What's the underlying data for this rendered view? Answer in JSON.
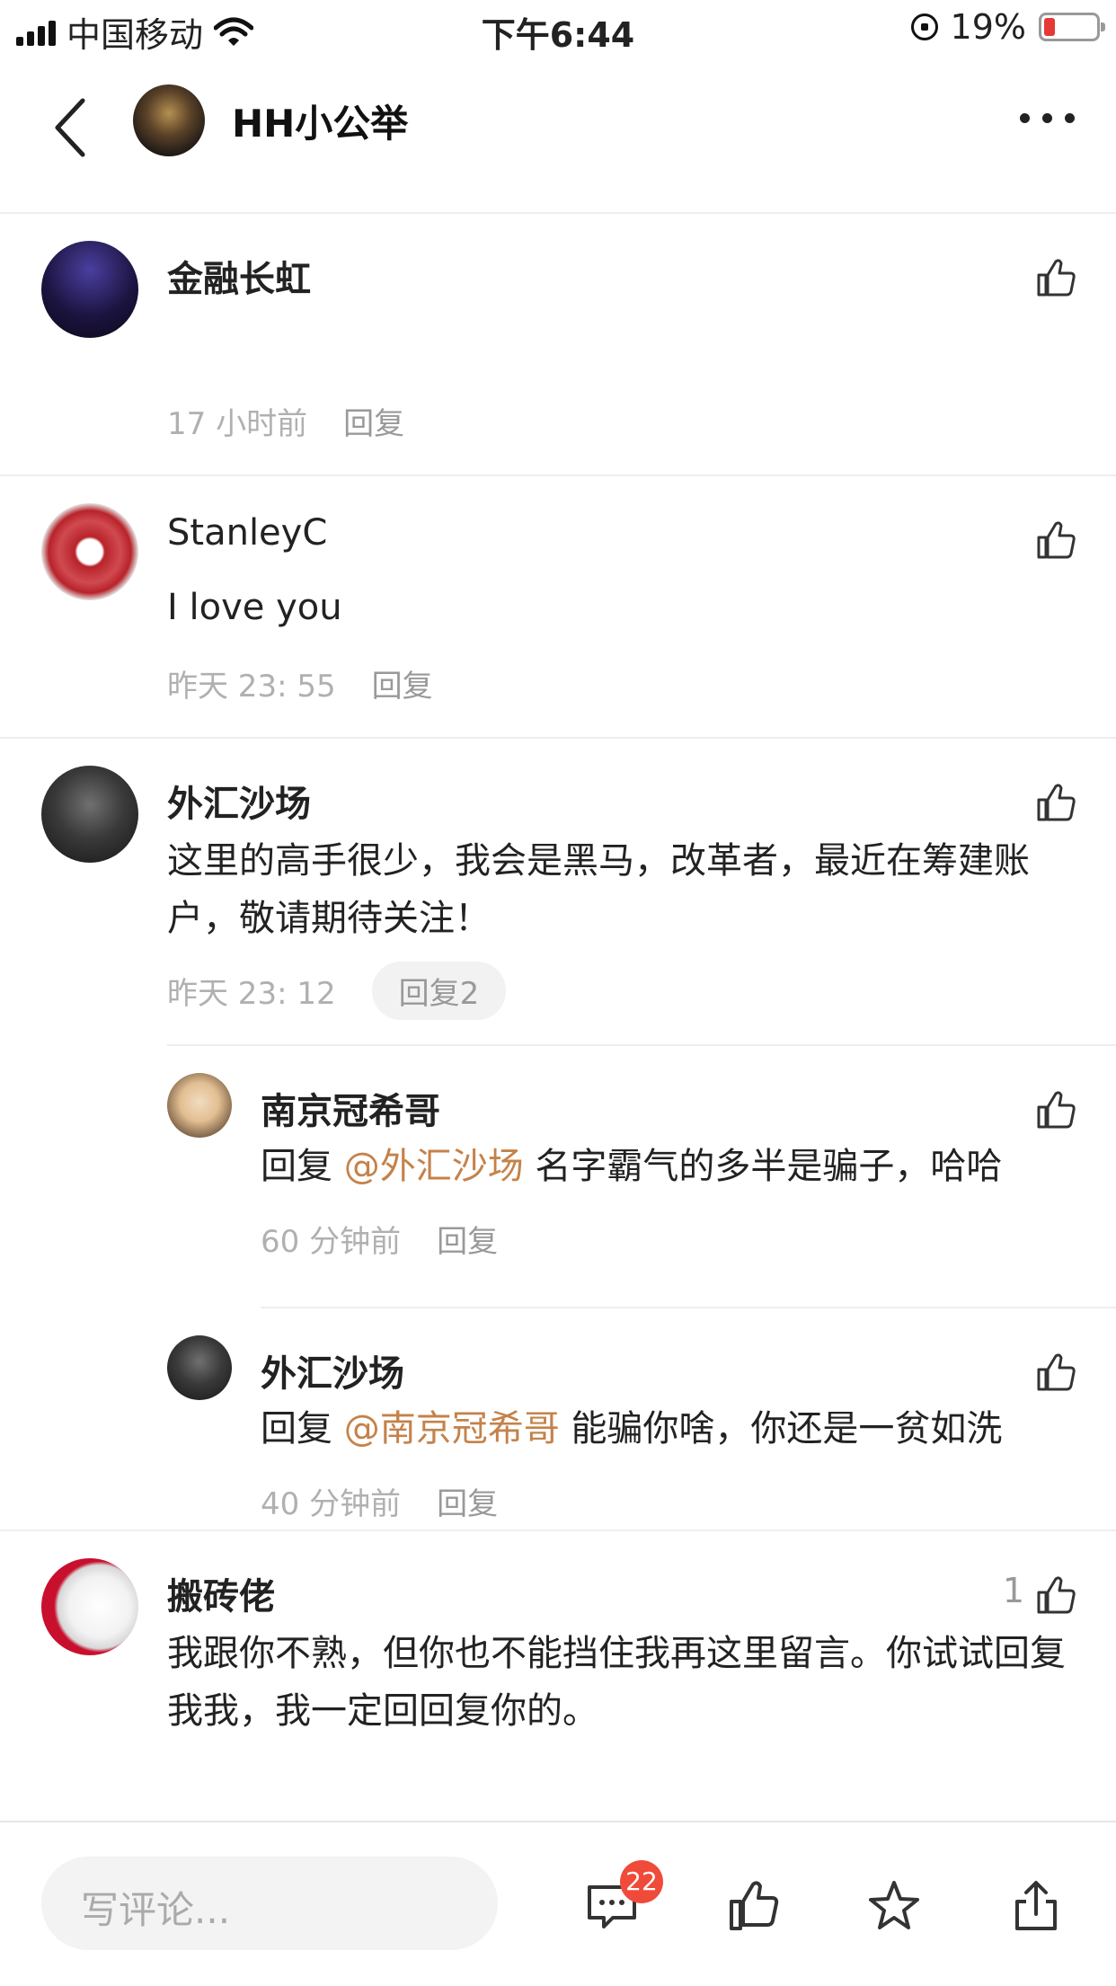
{
  "status_bar": {
    "carrier": "中国移动",
    "time": "下午6:44",
    "battery": "19%"
  },
  "header": {
    "title": "HH小公举"
  },
  "comments": [
    {
      "name": "金融长虹",
      "text": "",
      "time": "17 小时前",
      "reply": "回复"
    },
    {
      "name": "StanleyC",
      "text": "I love you",
      "time": "昨天 23: 55",
      "reply": "回复"
    },
    {
      "name": "外汇沙场",
      "text": "这里的高手很少，我会是黑马，改革者，最近在筹建账户，敬请期待关注！",
      "time": "昨天 23: 12",
      "reply": "回复2"
    },
    {
      "name": "搬砖佬",
      "text": "我跟你不熟，但你也不能挡住我再这里留言。你试试回复我我，我一定回回复你的。",
      "likes": "1"
    }
  ],
  "replies": [
    {
      "name": "南京冠希哥",
      "prefix": "回复",
      "mention": "@外汇沙场",
      "text": "名字霸气的多半是骗子，哈哈",
      "time": "60 分钟前",
      "reply": "回复"
    },
    {
      "name": "外汇沙场",
      "prefix": "回复",
      "mention": "@南京冠希哥",
      "text": "能骗你啥，你还是一贫如洗",
      "time": "40 分钟前",
      "reply": "回复"
    }
  ],
  "bottom_bar": {
    "placeholder": "写评论...",
    "comment_count": "22"
  },
  "colors": {
    "accent_mention": "#c4824a",
    "badge": "#f04a3a"
  }
}
